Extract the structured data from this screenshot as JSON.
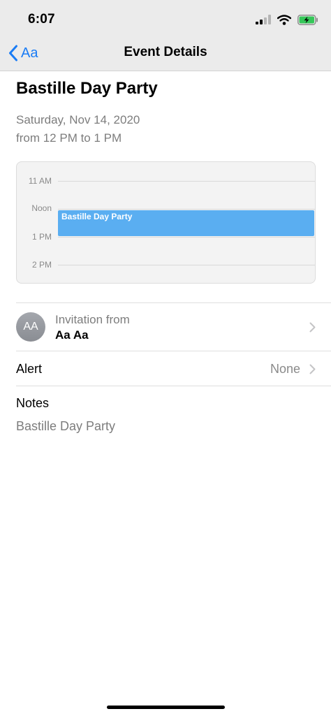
{
  "status_bar": {
    "time": "6:07",
    "icons": [
      "cellular-signal-icon",
      "wifi-icon",
      "battery-charging-icon"
    ]
  },
  "nav": {
    "back_label": "Aa",
    "title": "Event Details"
  },
  "event": {
    "title": "Bastille Day Party",
    "date": "Saturday, Nov 14, 2020",
    "time_range": "from 12 PM to 1 PM"
  },
  "day_preview": {
    "hours": [
      "11 AM",
      "Noon",
      "1 PM",
      "2 PM"
    ],
    "event_label": "Bastille Day Party",
    "event_color": "#5aaef1"
  },
  "invitation": {
    "avatar_initials": "AA",
    "label": "Invitation from",
    "name": "Aa Aa"
  },
  "alert": {
    "label": "Alert",
    "value": "None"
  },
  "notes": {
    "label": "Notes",
    "text": "Bastille Day Party"
  },
  "colors": {
    "accent": "#1a7cf5",
    "nav_background": "#ebebeb",
    "secondary_text": "#7d7d7d"
  }
}
